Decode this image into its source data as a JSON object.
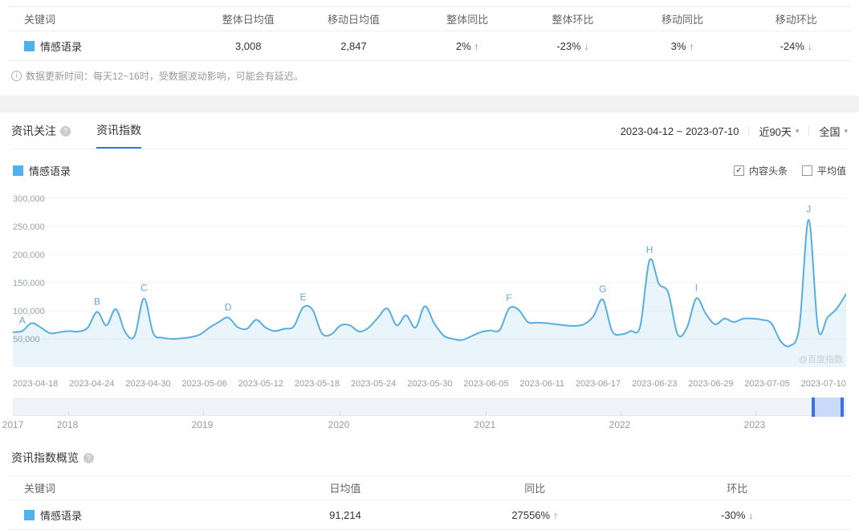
{
  "icons": {
    "help_icon": "?",
    "info_icon": "i",
    "check_icon": "✓",
    "caret_icon": "▾",
    "up_arrow": "↑",
    "down_arrow": "↓"
  },
  "colors": {
    "accent_blue": "#3c6ef0",
    "keyword_blue": "#50b2ec",
    "line_blue": "#58aede",
    "area_fill": "rgba(88,174,222,0.13)",
    "up_red": "#ee5145",
    "down_green": "#35b56f",
    "handle_blue": "#3a70ee",
    "selection_blue": "#c9dbf8",
    "grid_gray": "#f1f3f5"
  },
  "summary_table": {
    "headers": [
      "关键词",
      "整体日均值",
      "移动日均值",
      "整体同比",
      "整体环比",
      "移动同比",
      "移动环比"
    ],
    "row": {
      "keyword": "情感语录",
      "overall_daily_avg": "3,008",
      "mobile_daily_avg": "2,847",
      "overall_yoy": {
        "value": "2%",
        "direction": "up"
      },
      "overall_mom": {
        "value": "-23%",
        "direction": "down"
      },
      "mobile_yoy": {
        "value": "3%",
        "direction": "up"
      },
      "mobile_mom": {
        "value": "-24%",
        "direction": "down"
      }
    },
    "note": "数据更新时间：每天12~16时，受数据波动影响，可能会有延迟。"
  },
  "trend_panel": {
    "tabs": [
      {
        "label": "资讯关注",
        "active": false
      },
      {
        "label": "资讯指数",
        "active": true
      }
    ],
    "date_range": "2023-04-12 ~ 2023-07-10",
    "range_selector": "近90天",
    "region_selector": "全国",
    "legend_keyword": "情感语录",
    "checkboxes": [
      {
        "label": "内容头条",
        "checked": true
      },
      {
        "label": "平均值",
        "checked": false
      }
    ],
    "watermark": "@百度指数"
  },
  "chart_data": {
    "type": "area",
    "series_name": "情感语录",
    "x_start": "2023-04-12",
    "x_end": "2023-07-10",
    "x_tick_labels": [
      "2023-04-18",
      "2023-04-24",
      "2023-04-30",
      "2023-05-06",
      "2023-05-12",
      "2023-05-18",
      "2023-05-24",
      "2023-05-30",
      "2023-06-05",
      "2023-06-11",
      "2023-06-17",
      "2023-06-23",
      "2023-06-29",
      "2023-07-05",
      "2023-07-10"
    ],
    "y_ticks": [
      50000,
      100000,
      150000,
      200000,
      250000,
      300000
    ],
    "ylim": [
      0,
      320000
    ],
    "grid": true,
    "values": [
      62000,
      64000,
      78000,
      70000,
      60000,
      62000,
      64000,
      63000,
      70000,
      98000,
      74000,
      103000,
      62000,
      55000,
      122000,
      60000,
      52000,
      50000,
      51000,
      53000,
      58000,
      70000,
      80000,
      88000,
      71000,
      68000,
      84000,
      70000,
      64000,
      68000,
      72000,
      106000,
      102000,
      60000,
      58000,
      74000,
      74000,
      63000,
      70000,
      88000,
      104000,
      74000,
      92000,
      70000,
      108000,
      78000,
      56000,
      50000,
      48000,
      55000,
      62000,
      65000,
      66000,
      104000,
      102000,
      80000,
      79000,
      78000,
      76000,
      74000,
      73000,
      76000,
      90000,
      120000,
      64000,
      58000,
      64000,
      72000,
      190000,
      148000,
      132000,
      58000,
      70000,
      122000,
      95000,
      76000,
      86000,
      80000,
      86000,
      86000,
      84000,
      78000,
      46000,
      38000,
      72000,
      262000,
      68000,
      88000,
      104000,
      130000
    ],
    "annotations": [
      {
        "label": "A",
        "index": 1
      },
      {
        "label": "B",
        "index": 9
      },
      {
        "label": "C",
        "index": 14
      },
      {
        "label": "D",
        "index": 23
      },
      {
        "label": "E",
        "index": 31
      },
      {
        "label": "F",
        "index": 53
      },
      {
        "label": "G",
        "index": 63
      },
      {
        "label": "H",
        "index": 68
      },
      {
        "label": "I",
        "index": 73
      },
      {
        "label": "J",
        "index": 85
      }
    ]
  },
  "timeline": {
    "years": [
      "2017",
      "2018",
      "2019",
      "2020",
      "2021",
      "2022",
      "2023"
    ]
  },
  "overview_section": {
    "title": "资讯指数概览",
    "headers": [
      "关键词",
      "日均值",
      "同比",
      "环比"
    ],
    "row": {
      "keyword": "情感语录",
      "daily_avg": "91,214",
      "yoy": {
        "value": "27556%",
        "direction": "up"
      },
      "mom": {
        "value": "-30%",
        "direction": "down"
      }
    }
  }
}
